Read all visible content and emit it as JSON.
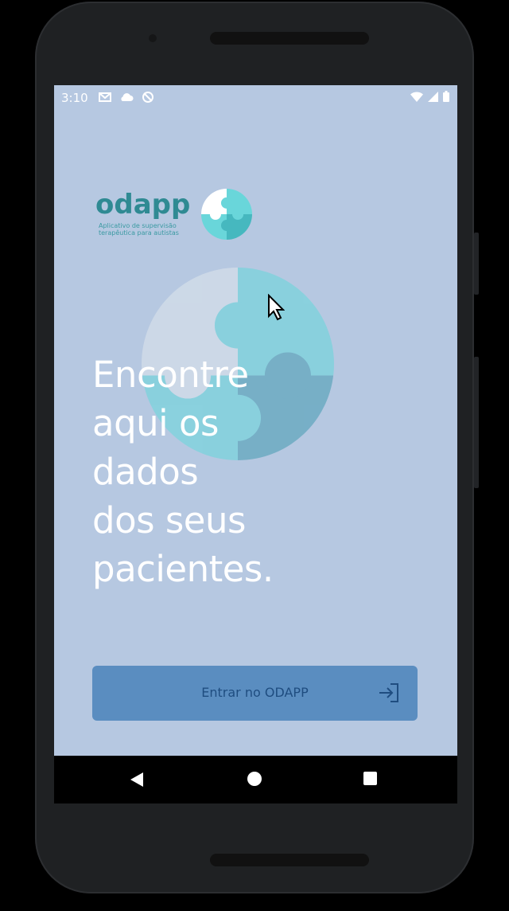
{
  "status_bar": {
    "time": "3:10",
    "left_icons": [
      "gmail-icon",
      "cloud-icon",
      "sync-off-icon"
    ],
    "right_icons": [
      "wifi-icon",
      "signal-icon",
      "battery-icon"
    ]
  },
  "logo": {
    "name": "odapp",
    "tagline_line1": "Aplicativo de supervisão",
    "tagline_line2": "terapêutica para autistas"
  },
  "headline": "Encontre\naqui os\ndados\ndos seus\npacientes.",
  "enter_button": {
    "label": "Entrar no ODAPP",
    "icon": "login-icon"
  },
  "navigation": {
    "back": "back-icon",
    "home": "home-icon",
    "recents": "recents-icon"
  },
  "colors": {
    "screen_background": "#b6c8e1",
    "brand_teal": "#2f8a93",
    "puzzle_cyan": "#69d6da",
    "button_blue": "#5a8dc0",
    "button_text": "#1f4d80"
  }
}
